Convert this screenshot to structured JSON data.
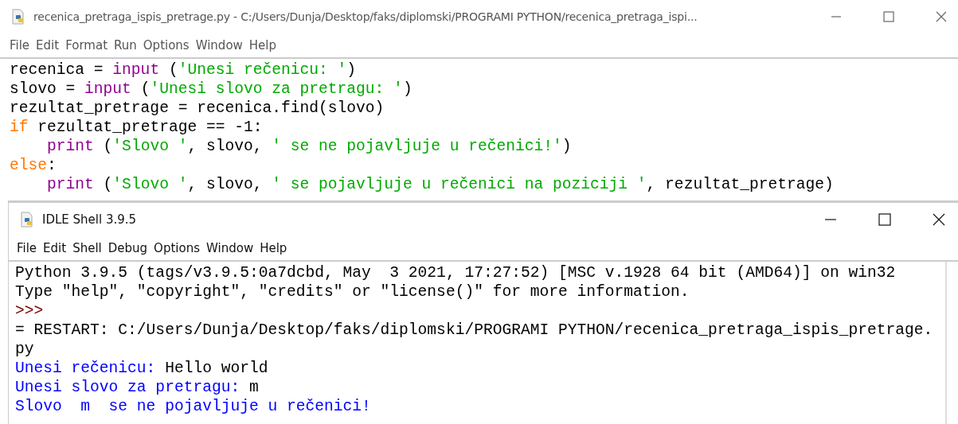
{
  "editor": {
    "title": "recenica_pretraga_ispis_pretrage.py - C:/Users/Dunja/Desktop/faks/diplomski/PROGRAMI PYTHON/recenica_pretraga_ispi...",
    "menu": [
      "File",
      "Edit",
      "Format",
      "Run",
      "Options",
      "Window",
      "Help"
    ],
    "lines": [
      [
        {
          "kind": "plain",
          "text": "recenica = "
        },
        {
          "kind": "builtin",
          "text": "input"
        },
        {
          "kind": "plain",
          "text": " ("
        },
        {
          "kind": "string",
          "text": "'Unesi rečenicu: '"
        },
        {
          "kind": "plain",
          "text": ")"
        }
      ],
      [
        {
          "kind": "plain",
          "text": "slovo = "
        },
        {
          "kind": "builtin",
          "text": "input"
        },
        {
          "kind": "plain",
          "text": " ("
        },
        {
          "kind": "string",
          "text": "'Unesi slovo za pretragu: '"
        },
        {
          "kind": "plain",
          "text": ")"
        }
      ],
      [
        {
          "kind": "plain",
          "text": "rezultat_pretrage = recenica.find(slovo)"
        }
      ],
      [
        {
          "kind": "keyword",
          "text": "if"
        },
        {
          "kind": "plain",
          "text": " rezultat_pretrage == -1:"
        }
      ],
      [
        {
          "kind": "builtin",
          "text": "    print"
        },
        {
          "kind": "plain",
          "text": " ("
        },
        {
          "kind": "string",
          "text": "'Slovo '"
        },
        {
          "kind": "plain",
          "text": ", slovo, "
        },
        {
          "kind": "string",
          "text": "' se ne pojavljuje u rečenici!'"
        },
        {
          "kind": "plain",
          "text": ")"
        }
      ],
      [
        {
          "kind": "keyword",
          "text": "else"
        },
        {
          "kind": "plain",
          "text": ":"
        }
      ],
      [
        {
          "kind": "builtin",
          "text": "    print"
        },
        {
          "kind": "plain",
          "text": " ("
        },
        {
          "kind": "string",
          "text": "'Slovo '"
        },
        {
          "kind": "plain",
          "text": ", slovo, "
        },
        {
          "kind": "string",
          "text": "' se pojavljuje u rečenici na poziciji '"
        },
        {
          "kind": "plain",
          "text": ", rezultat_pretrage)"
        }
      ]
    ]
  },
  "shell": {
    "title": "IDLE Shell 3.9.5",
    "menu": [
      "File",
      "Edit",
      "Shell",
      "Debug",
      "Options",
      "Window",
      "Help"
    ],
    "lines": [
      [
        {
          "kind": "plain",
          "text": "Python 3.9.5 (tags/v3.9.5:0a7dcbd, May  3 2021, 17:27:52) [MSC v.1928 64 bit (AMD64)] on win32"
        }
      ],
      [
        {
          "kind": "plain",
          "text": "Type \"help\", \"copyright\", \"credits\" or \"license()\" for more information."
        }
      ],
      [
        {
          "kind": "prompt",
          "text": ">>>"
        }
      ],
      [
        {
          "kind": "plain",
          "text": "= RESTART: C:/Users/Dunja/Desktop/faks/diplomski/PROGRAMI PYTHON/recenica_pretraga_ispis_pretrage."
        }
      ],
      [
        {
          "kind": "plain",
          "text": "py"
        }
      ],
      [
        {
          "kind": "output",
          "text": "Unesi rečenicu: "
        },
        {
          "kind": "plain",
          "text": "Hello world"
        }
      ],
      [
        {
          "kind": "output",
          "text": "Unesi slovo za pretragu: "
        },
        {
          "kind": "plain",
          "text": "m"
        }
      ],
      [
        {
          "kind": "output",
          "text": "Slovo  m  se ne pojavljuje u rečenici!"
        }
      ]
    ]
  }
}
